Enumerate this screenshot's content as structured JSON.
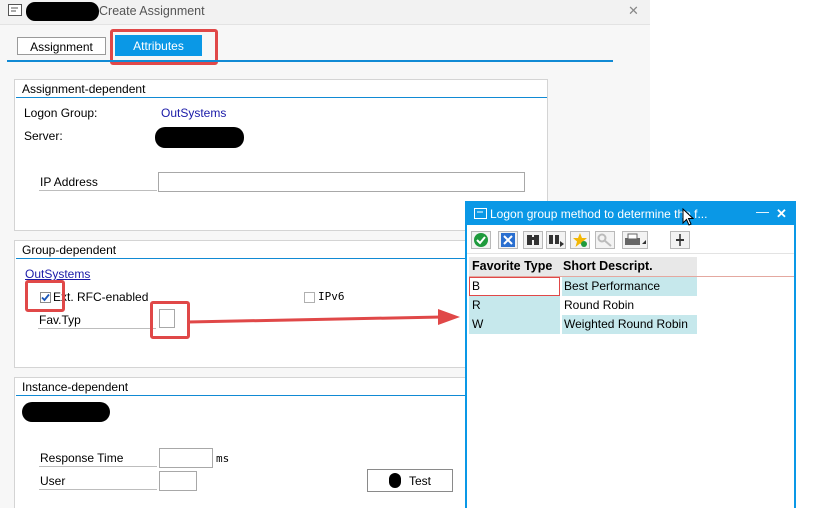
{
  "window": {
    "title": "Create Assignment",
    "close_glyph": "✕"
  },
  "tabs": [
    {
      "label": "Assignment",
      "active": false
    },
    {
      "label": "Attributes",
      "active": true
    }
  ],
  "assignment_dependent": {
    "title": "Assignment-dependent",
    "logon_group_label": "Logon Group:",
    "logon_group_value": "OutSystems",
    "server_label": "Server:",
    "ip_address_label": "IP Address",
    "ip_address_value": ""
  },
  "group_dependent": {
    "title": "Group-dependent",
    "group_name": "OutSystems",
    "ext_rfc_label": "Ext. RFC-enabled",
    "ext_rfc_checked": true,
    "ipv6_label": "IPv6",
    "ipv6_checked": false,
    "fav_typ_label": "Fav.Typ",
    "fav_typ_value": ""
  },
  "instance_dependent": {
    "title": "Instance-dependent",
    "response_time_label": "Response Time",
    "response_time_value": "",
    "response_time_unit": "ms",
    "user_label": "User",
    "user_value": "",
    "test_button_label": "Test"
  },
  "popup": {
    "title": "Logon group method to determine the f...",
    "minimize_glyph": "—",
    "close_glyph": "✕",
    "toolbar": [
      "check-icon",
      "cancel-icon",
      "binoculars-icon",
      "binoculars-next-icon",
      "add-favorite-icon",
      "key-icon",
      "print-icon",
      "pin-icon"
    ],
    "columns": [
      "Favorite Type",
      "Short Descript."
    ],
    "rows": [
      {
        "type": "B",
        "desc": "Best Performance"
      },
      {
        "type": "R",
        "desc": "Round Robin"
      },
      {
        "type": "W",
        "desc": "Weighted Round Robin"
      }
    ]
  },
  "colors": {
    "accent": "#0a98e6",
    "highlight_red": "#e04848",
    "row_bg": "#c6e8ec"
  }
}
